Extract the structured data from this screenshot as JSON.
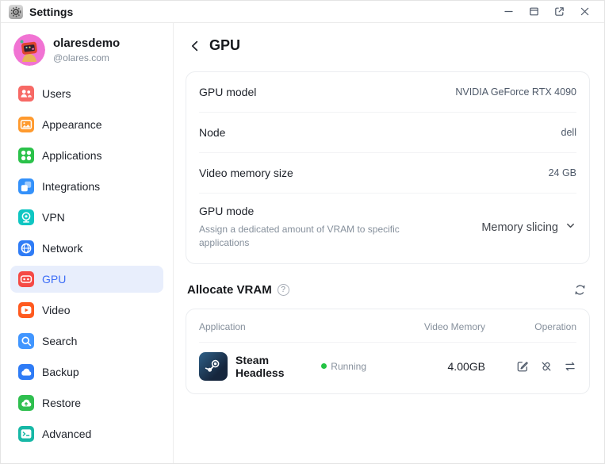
{
  "window": {
    "title": "Settings",
    "controls": [
      {
        "name": "minimize"
      },
      {
        "name": "restore"
      },
      {
        "name": "popout"
      },
      {
        "name": "close"
      }
    ]
  },
  "sidebar": {
    "user": {
      "name": "olaresdemo",
      "handle": "@olares.com"
    },
    "items": [
      {
        "label": "Users",
        "icon": "users",
        "color": "#F76965",
        "selected": false
      },
      {
        "label": "Appearance",
        "icon": "appearance",
        "color": "#FF9A2E",
        "selected": false
      },
      {
        "label": "Applications",
        "icon": "applications",
        "color": "#2BC24A",
        "selected": false
      },
      {
        "label": "Integrations",
        "icon": "integrations",
        "color": "#3491FA",
        "selected": false
      },
      {
        "label": "VPN",
        "icon": "vpn",
        "color": "#0FC6C2",
        "selected": false
      },
      {
        "label": "Network",
        "icon": "network",
        "color": "#2F7CF6",
        "selected": false
      },
      {
        "label": "GPU",
        "icon": "gpu",
        "color": "#F54A45",
        "selected": true
      },
      {
        "label": "Video",
        "icon": "video",
        "color": "#FF5A1F",
        "selected": false
      },
      {
        "label": "Search",
        "icon": "search",
        "color": "#4196FF",
        "selected": false
      },
      {
        "label": "Backup",
        "icon": "backup",
        "color": "#2F7CF6",
        "selected": false
      },
      {
        "label": "Restore",
        "icon": "restore",
        "color": "#2FBF4F",
        "selected": false
      },
      {
        "label": "Advanced",
        "icon": "advanced",
        "color": "#17B8A6",
        "selected": false
      }
    ]
  },
  "main": {
    "title": "GPU",
    "info_rows": [
      {
        "label": "GPU model",
        "value": "NVIDIA GeForce RTX 4090"
      },
      {
        "label": "Node",
        "value": "dell"
      },
      {
        "label": "Video memory size",
        "value": "24 GB"
      },
      {
        "label": "GPU mode",
        "description": "Assign a dedicated amount of VRAM to specific applications",
        "value": "Memory slicing",
        "dropdown": true
      }
    ],
    "allocate": {
      "title": "Allocate VRAM",
      "table": {
        "headers": [
          "Application",
          "Video Memory",
          "Operation"
        ],
        "rows": [
          {
            "app": "Steam Headless",
            "status": "Running",
            "memory": "4.00GB",
            "operations": [
              "edit",
              "unbind",
              "restart"
            ]
          }
        ]
      }
    }
  },
  "colors": {
    "accent": "#3D6EF7",
    "selected_bg": "#E8EEFC",
    "status_running": "#23C343"
  }
}
